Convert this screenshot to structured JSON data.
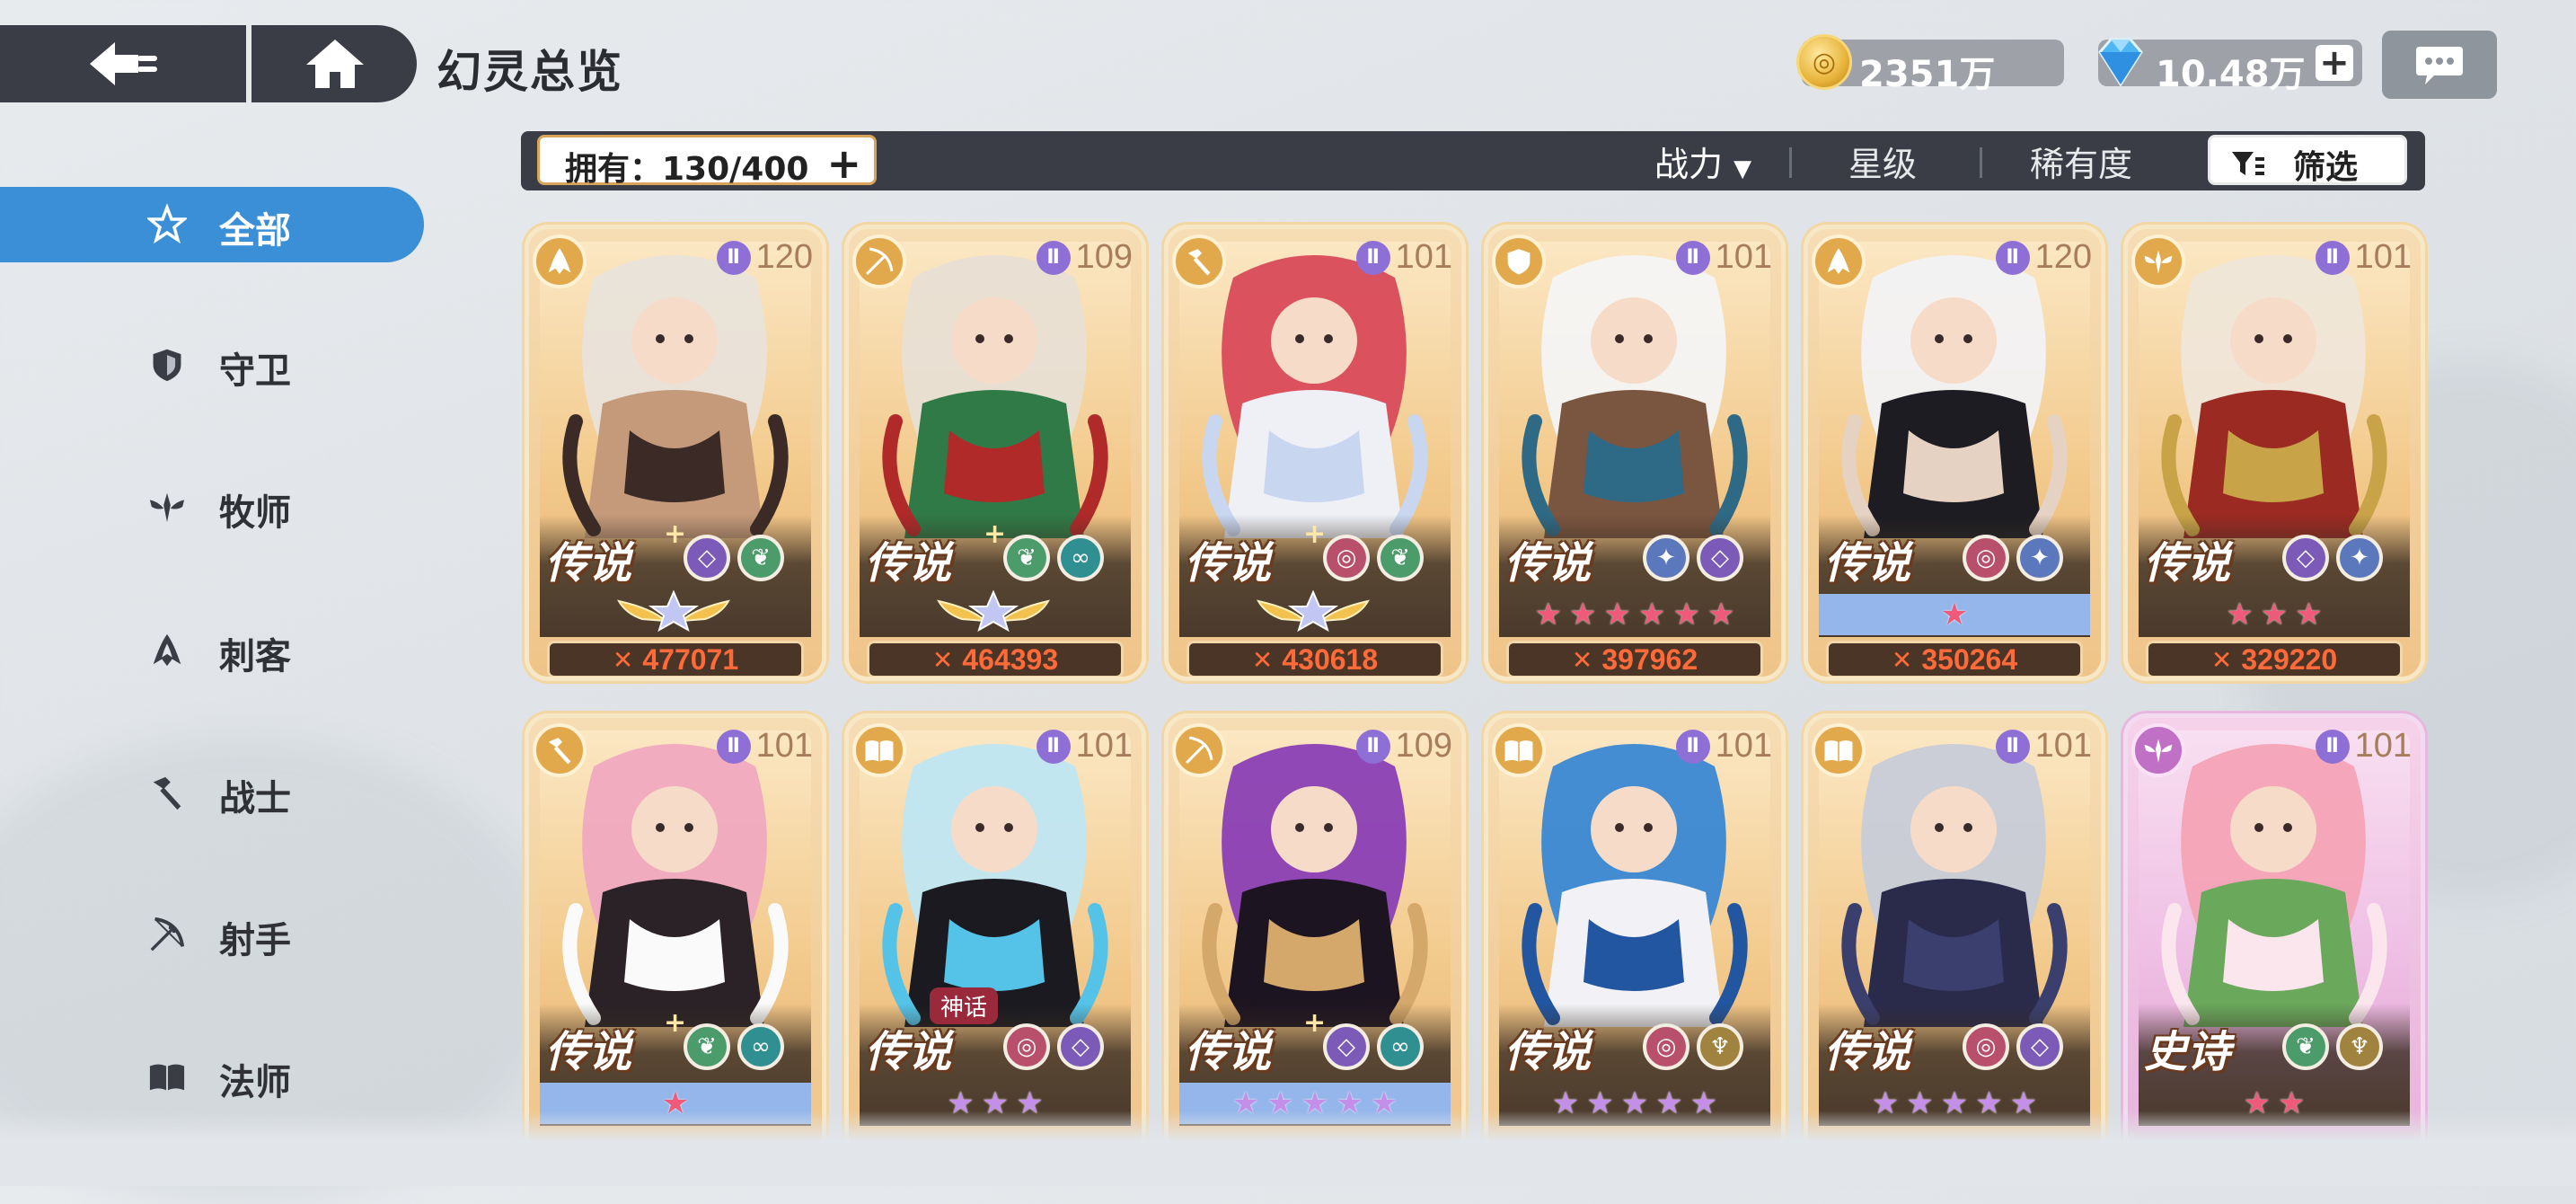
{
  "header": {
    "title": "幻灵总览",
    "gold": "2351万",
    "gems": "10.48万",
    "gem_plus": "+"
  },
  "filter_bar": {
    "owned": "拥有：130/400",
    "owned_plus": "+",
    "sort_power": "战力",
    "sort_power_arrow": "▼",
    "sort_star": "星级",
    "sort_rarity": "稀有度",
    "filter": "筛选"
  },
  "sidebar": {
    "items": [
      {
        "label": "全部",
        "icon": "all-icon",
        "active": true
      },
      {
        "label": "守卫",
        "icon": "shield-icon",
        "active": false
      },
      {
        "label": "牧师",
        "icon": "priest-icon",
        "active": false
      },
      {
        "label": "刺客",
        "icon": "assassin-icon",
        "active": false
      },
      {
        "label": "战士",
        "icon": "warrior-icon",
        "active": false
      },
      {
        "label": "射手",
        "icon": "archer-icon",
        "active": false
      },
      {
        "label": "法师",
        "icon": "mage-icon",
        "active": false
      }
    ]
  },
  "cards": [
    {
      "level": "120",
      "rarity": "传说",
      "plus": "+",
      "power": "477071",
      "class_icon": "assassin-icon",
      "elements": [
        "purple",
        "green"
      ],
      "stars_type": "wing",
      "star_count": 0
    },
    {
      "level": "109",
      "rarity": "传说",
      "plus": "+",
      "power": "464393",
      "class_icon": "archer-icon",
      "elements": [
        "green",
        "teal"
      ],
      "stars_type": "wing",
      "star_count": 0
    },
    {
      "level": "101",
      "rarity": "传说",
      "plus": "+",
      "power": "430618",
      "class_icon": "warrior-icon",
      "elements": [
        "swirl",
        "green"
      ],
      "stars_type": "wing",
      "star_count": 0
    },
    {
      "level": "101",
      "rarity": "传说",
      "plus": "",
      "power": "397962",
      "class_icon": "shield-icon",
      "elements": [
        "blue",
        "purple"
      ],
      "stars_type": "red",
      "star_count": 6
    },
    {
      "level": "120",
      "rarity": "传说",
      "plus": "",
      "power": "350264",
      "class_icon": "assassin-icon",
      "elements": [
        "swirl",
        "blue"
      ],
      "stars_type": "red-blue",
      "star_count": 1
    },
    {
      "level": "101",
      "rarity": "传说",
      "plus": "",
      "power": "329220",
      "class_icon": "priest-icon",
      "elements": [
        "purple",
        "blue"
      ],
      "stars_type": "red",
      "star_count": 3
    },
    {
      "level": "101",
      "rarity": "传说",
      "plus": "+",
      "power": "",
      "class_icon": "warrior-icon",
      "elements": [
        "green",
        "teal"
      ],
      "stars_type": "red-blue",
      "star_count": 1
    },
    {
      "level": "101",
      "rarity": "传说",
      "plus": "",
      "power": "",
      "class_icon": "mage-icon",
      "elements": [
        "swirl",
        "purple"
      ],
      "stars_type": "purple",
      "star_count": 3,
      "tag": "神话"
    },
    {
      "level": "109",
      "rarity": "传说",
      "plus": "+",
      "power": "",
      "class_icon": "archer-icon",
      "elements": [
        "purple",
        "teal"
      ],
      "stars_type": "purple-blue",
      "star_count": 5
    },
    {
      "level": "101",
      "rarity": "传说",
      "plus": "",
      "power": "",
      "class_icon": "mage-icon",
      "elements": [
        "swirl",
        "gold"
      ],
      "stars_type": "purple",
      "star_count": 5
    },
    {
      "level": "101",
      "rarity": "传说",
      "plus": "",
      "power": "",
      "class_icon": "mage-icon",
      "elements": [
        "swirl",
        "purple"
      ],
      "stars_type": "purple",
      "star_count": 5
    },
    {
      "level": "101",
      "rarity": "史诗",
      "plus": "",
      "power": "",
      "class_icon": "priest-icon",
      "elements": [
        "green",
        "gold"
      ],
      "stars_type": "red",
      "star_count": 2,
      "epic": true
    }
  ],
  "colors": {
    "accent_blue": "#3b8fd6",
    "dark_bar": "#3a3d46",
    "power_orange": "#ff6a3a",
    "card_gold": "#efc489",
    "card_epic": "#e7b2db"
  }
}
